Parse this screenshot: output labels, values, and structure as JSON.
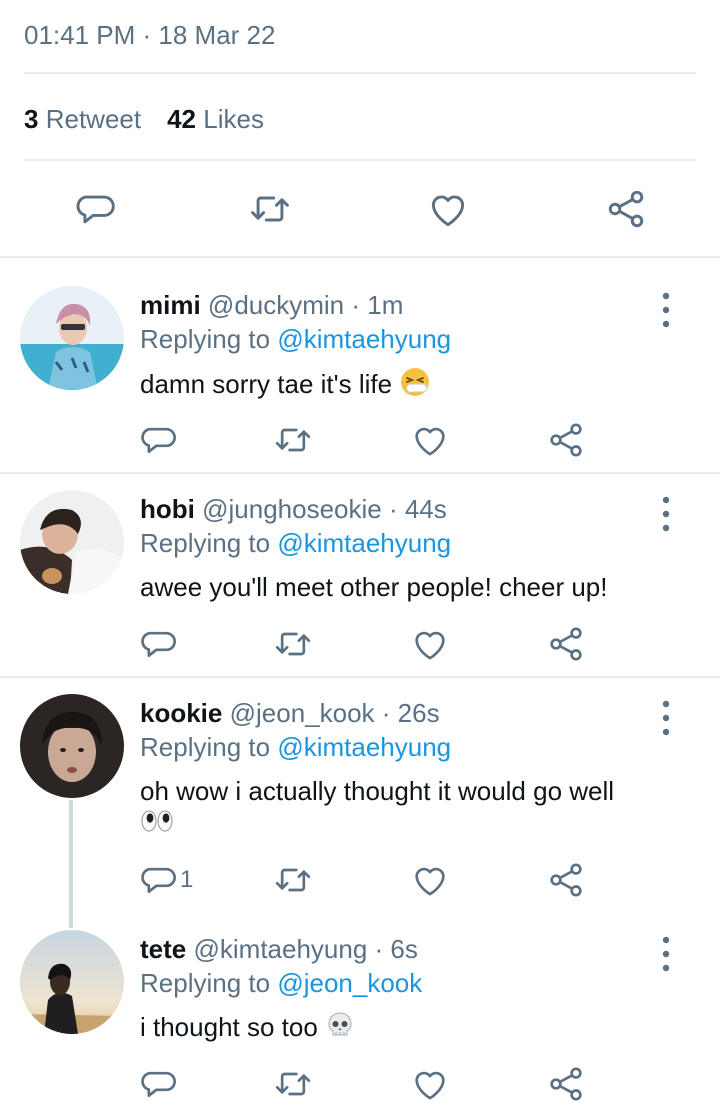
{
  "tweet": {
    "timestamp": "01:41 PM · 18 Mar 22",
    "retweet_count": "3",
    "retweet_label": "Retweet",
    "like_count": "42",
    "like_label": "Likes"
  },
  "replies": [
    {
      "name": "mimi",
      "handle": "@duckymin · 1m",
      "replying_label": "Replying to",
      "replying_to": "@kimtaehyung",
      "text": "damn sorry tae it's life",
      "emoji": "sneezing-face",
      "reply_count": ""
    },
    {
      "name": "hobi",
      "handle": "@junghoseokie · 44s",
      "replying_label": "Replying to",
      "replying_to": "@kimtaehyung",
      "text": "awee you'll meet other people! cheer up!",
      "reply_count": ""
    },
    {
      "name": "kookie",
      "handle": "@jeon_kook · 26s",
      "replying_label": "Replying to",
      "replying_to": "@kimtaehyung",
      "text": "oh wow i actually thought it would go well",
      "emoji": "eyes",
      "reply_count": "1"
    },
    {
      "name": "tete",
      "handle": "@kimtaehyung · 6s",
      "replying_label": "Replying to",
      "replying_to": "@jeon_kook",
      "text": "i thought so too",
      "emoji": "skull",
      "reply_count": ""
    }
  ],
  "colors": {
    "accent": "#1b95e0",
    "secondary_text": "#5b7083",
    "divider": "#e6ecf0",
    "thread_line": "#cfd9de"
  }
}
